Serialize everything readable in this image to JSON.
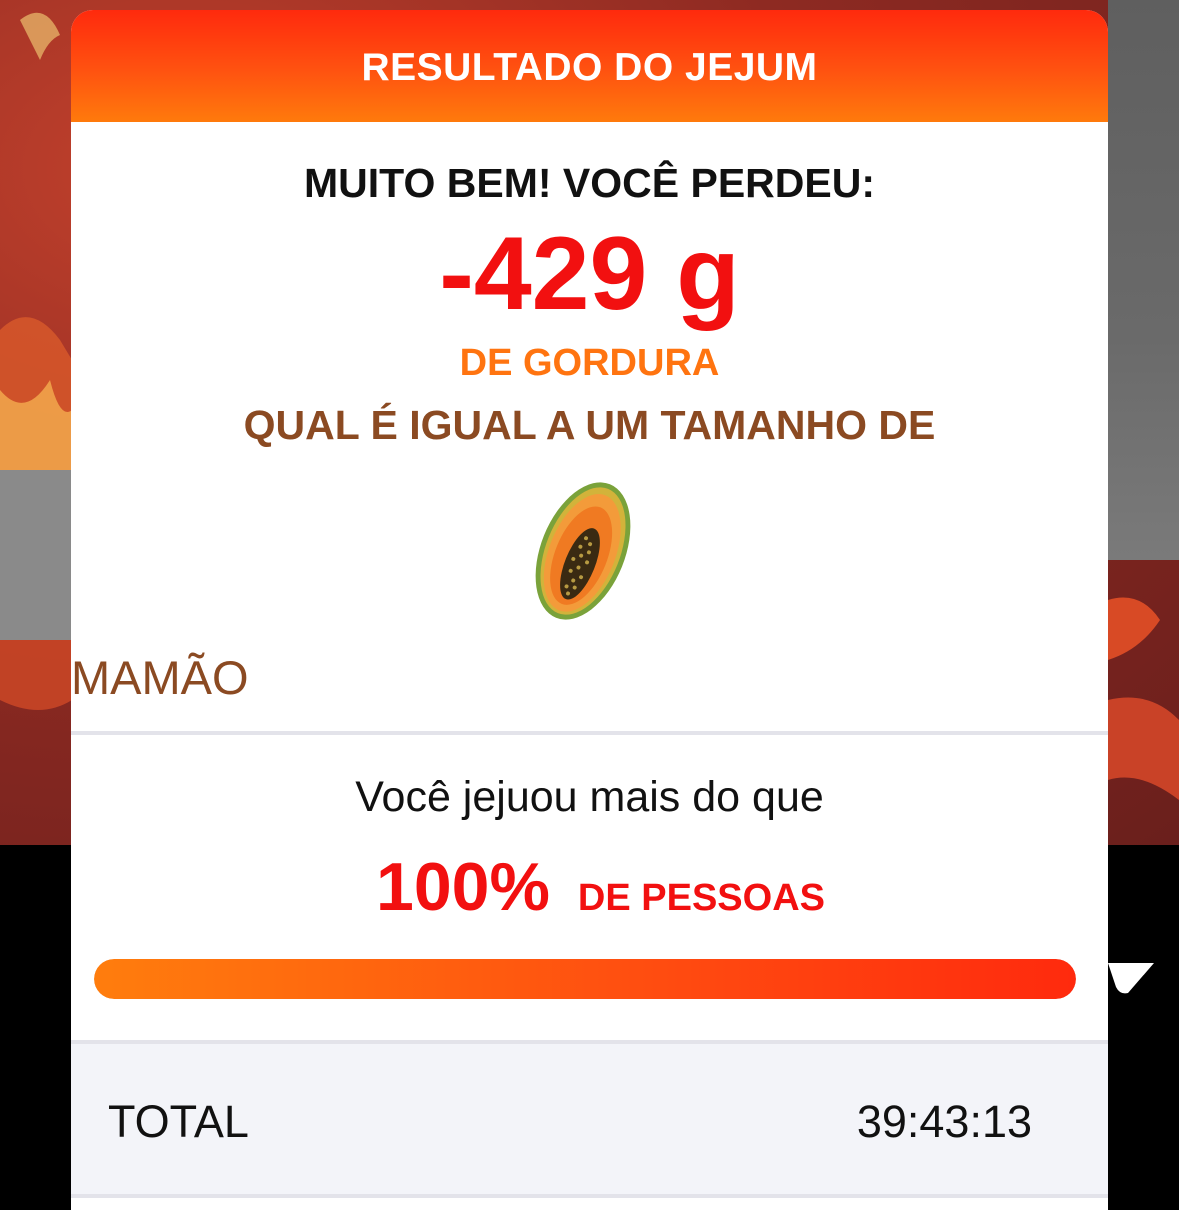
{
  "modal": {
    "title": "RESULTADO DO JEJUM"
  },
  "result": {
    "headline": "MUITO BEM! VOCÊ PERDEU:",
    "amount": "-429 g",
    "unit_label": "DE GORDURA",
    "compare_label": "QUAL É IGUAL A UM TAMANHO DE",
    "fruit_icon": "papaya-icon",
    "fruit_name": "MAMÃO"
  },
  "ranking": {
    "text": "Você jejuou mais do que",
    "percent": "100%",
    "suffix": "DE PESSOAS",
    "progress_fraction": 1.0
  },
  "stats": {
    "total_label": "TOTAL",
    "total_value": "39:43:13"
  },
  "colors": {
    "header_gradient_top": "#ff2a0d",
    "header_gradient_bottom": "#ff7a0c",
    "amount_red": "#f21010",
    "unit_orange": "#ff7410",
    "brown": "#8b4a22"
  }
}
